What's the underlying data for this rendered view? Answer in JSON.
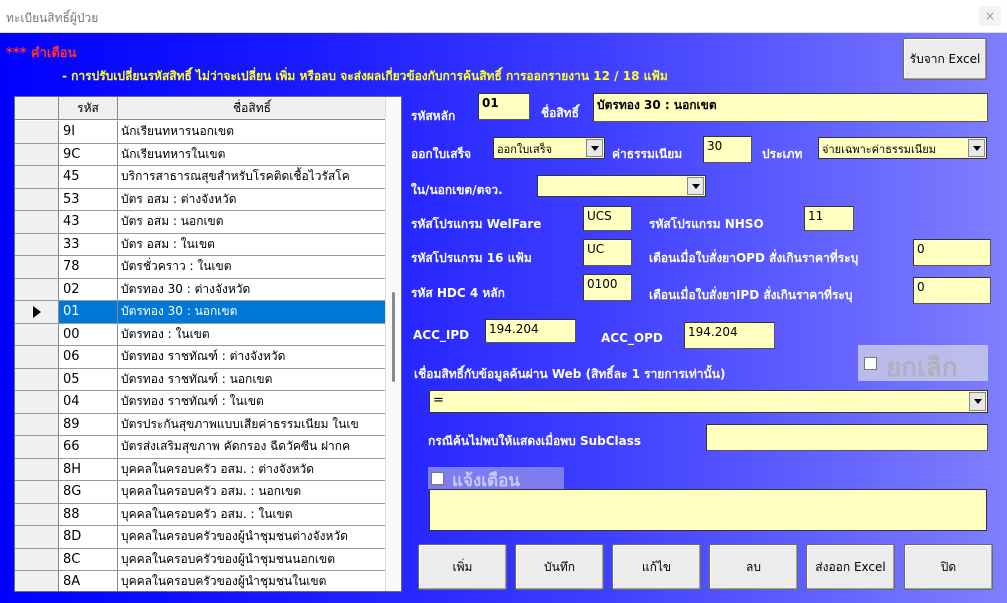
{
  "window": {
    "title": "ทะเบียนสิทธิ์ผู้ป่วย",
    "close_label": "×"
  },
  "warning": {
    "title": "*** คำเตือน",
    "text": "- การปรับเปลี่ยนรหัสสิทธิ์ ไม่ว่าจะเปลี่ยน เพิ่ม หรือลบ จะส่งผลเกี่ยวข้องกับการค้นสิทธิ์ การออกรายงาน 12 / 18 แฟ้ม"
  },
  "import_button": "รับจาก Excel",
  "grid": {
    "headers": {
      "code": "รหัส",
      "name": "ชื่อสิทธิ์"
    },
    "rows": [
      {
        "code": "9I",
        "name": "นักเรียนทหารนอกเขต"
      },
      {
        "code": "9C",
        "name": "นักเรียนทหารในเขต"
      },
      {
        "code": "45",
        "name": "บริการสาธารณสุขสำหรับโรคติดเชื้อไวรัสโค"
      },
      {
        "code": "53",
        "name": "บัตร อสม : ต่างจังหวัด"
      },
      {
        "code": "43",
        "name": "บัตร อสม : นอกเขต"
      },
      {
        "code": "33",
        "name": "บัตร อสม : ในเขต"
      },
      {
        "code": "78",
        "name": "บัตรชั่วคราว : ในเขต"
      },
      {
        "code": "02",
        "name": "บัตรทอง 30 : ต่างจังหวัด"
      },
      {
        "code": "01",
        "name": "บัตรทอง 30 : นอกเขต"
      },
      {
        "code": "00",
        "name": "บัตรทอง : ในเขต"
      },
      {
        "code": "06",
        "name": "บัตรทอง ราชทัณฑ์ : ต่างจังหวัด"
      },
      {
        "code": "05",
        "name": "บัตรทอง ราชทัณฑ์ : นอกเขต"
      },
      {
        "code": "04",
        "name": "บัตรทอง ราชทัณฑ์ : ในเขต"
      },
      {
        "code": "89",
        "name": "บัตรประกันสุขภาพแบบเสียค่าธรรมเนียม ในเข"
      },
      {
        "code": "66",
        "name": "บัตรส่งเสริมสุขภาพ คัดกรอง ฉีดวัคซีน ฝากค"
      },
      {
        "code": "8H",
        "name": "บุคคลในครอบครัว อสม. : ต่างจังหวัด"
      },
      {
        "code": "8G",
        "name": "บุคคลในครอบครัว อสม. : นอกเขต"
      },
      {
        "code": "88",
        "name": "บุคคลในครอบครัว อสม. : ในเขต"
      },
      {
        "code": "8D",
        "name": "บุคคลในครอบครัวของผู้นำชุมชนต่างจังหวัด"
      },
      {
        "code": "8C",
        "name": "บุคคลในครอบครัวของผู้นำชุมชนนอกเขต"
      },
      {
        "code": "8A",
        "name": "บุคคลในครอบครัวของผู้นำชุมชนในเขต"
      }
    ],
    "selected_index": 8
  },
  "form": {
    "main_code_label": "รหัสหลัก",
    "main_code": "01",
    "right_name_label": "ชื่อสิทธิ์",
    "right_name": "บัตรทอง 30 : นอกเขต",
    "receipt_label": "ออกใบเสร็จ",
    "receipt_value": "ออกใบเสร็จ",
    "fee_label": "ค่าธรรมเนียม",
    "fee_value": "30",
    "type_label": "ประเภท",
    "type_value": "จ่ายเฉพาะค่าธรรมเนียม",
    "area_label": "ใน/นอกเขต/ตจว.",
    "area_value": "",
    "welfare_label": "รหัสโปรแกรม WelFare",
    "welfare_value": "UCS",
    "nhso_label": "รหัสโปรแกรม NHSO",
    "nhso_value": "11",
    "f16_label": "รหัสโปรแกรม 16 แฟ้ม",
    "f16_value": "UC",
    "opd_warn_label": "เตือนเมื่อใบสั่งยาOPD  สั่งเกินราคาที่ระบุ",
    "opd_warn_value": "0",
    "hdc_label": "รหัส HDC 4 หลัก",
    "hdc_value": "0100",
    "ipd_warn_label": "เตือนเมื่อใบสั่งยาIPD  สั่งเกินราคาที่ระบุ",
    "ipd_warn_value": "0",
    "acc_ipd_label": "ACC_IPD",
    "acc_ipd_value": "194.204",
    "acc_opd_label": "ACC_OPD",
    "acc_opd_value": "194.204",
    "cancel_label": "ยกเลิก",
    "web_link_label": "เชื่อมสิทธิ์กับข้อมูลค้นผ่าน Web (สิทธิ์ละ 1 รายการเท่านั้น)",
    "web_link_value": "=",
    "subclass_label": "กรณีค้นไม่พบให้แสดงเมื่อพบ SubClass",
    "subclass_value": "",
    "notify_label": "แจ้งเตือน",
    "notify_text": ""
  },
  "buttons": {
    "add": "เพิ่ม",
    "save": "บันทึก",
    "edit": "แก้ไข",
    "delete": "ลบ",
    "export": "ส่งออก Excel",
    "close": "ปิด"
  }
}
